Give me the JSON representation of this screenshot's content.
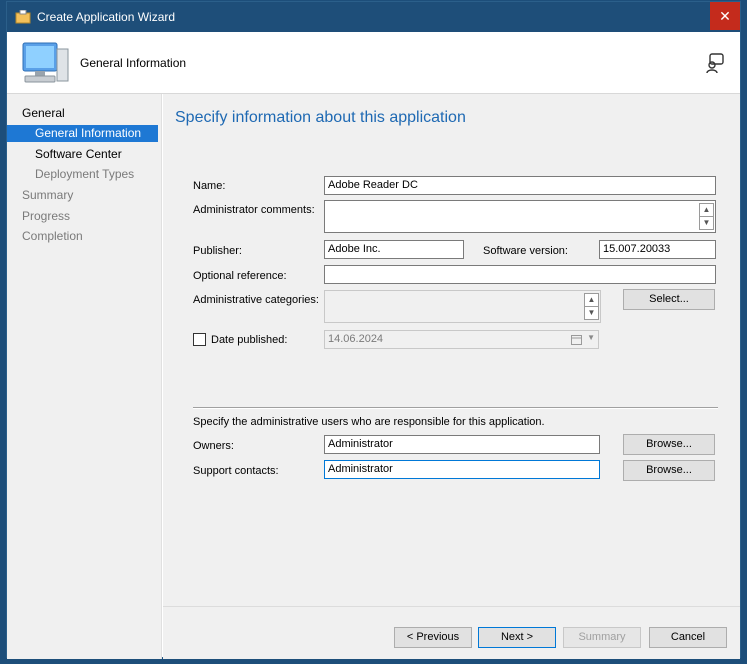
{
  "window": {
    "title": "Create Application Wizard",
    "close_glyph": "✕"
  },
  "header": {
    "heading": "General Information"
  },
  "sidebar": {
    "items": [
      {
        "label": "General"
      },
      {
        "label": "General Information"
      },
      {
        "label": "Software Center"
      },
      {
        "label": "Deployment Types"
      },
      {
        "label": "Summary"
      },
      {
        "label": "Progress"
      },
      {
        "label": "Completion"
      }
    ]
  },
  "content": {
    "title": "Specify information about this application",
    "name": {
      "label": "Name:",
      "value": "Adobe Reader DC"
    },
    "admin_comments": {
      "label": "Administrator comments:",
      "value": ""
    },
    "publisher": {
      "label": "Publisher:",
      "value": "Adobe Inc."
    },
    "software_version": {
      "label": "Software version:",
      "value": "15.007.20033"
    },
    "optional_reference": {
      "label": "Optional reference:",
      "value": ""
    },
    "admin_categories": {
      "label": "Administrative categories:",
      "select_label": "Select..."
    },
    "date_published": {
      "label": "Date published:",
      "value": "14.06.2024"
    },
    "responsible_note": "Specify the administrative users who are responsible for this application.",
    "owners": {
      "label": "Owners:",
      "value": "Administrator",
      "browse_label": "Browse..."
    },
    "support_contacts": {
      "label": "Support contacts:",
      "value": "Administrator",
      "browse_label": "Browse..."
    }
  },
  "footer": {
    "previous_label": "< Previous",
    "next_label": "Next >",
    "summary_label": "Summary",
    "cancel_label": "Cancel"
  },
  "icons": [
    "wizard-app-icon",
    "computer-icon",
    "help-icon",
    "close-icon",
    "calendar-icon",
    "spin-up-icon",
    "spin-down-icon"
  ]
}
